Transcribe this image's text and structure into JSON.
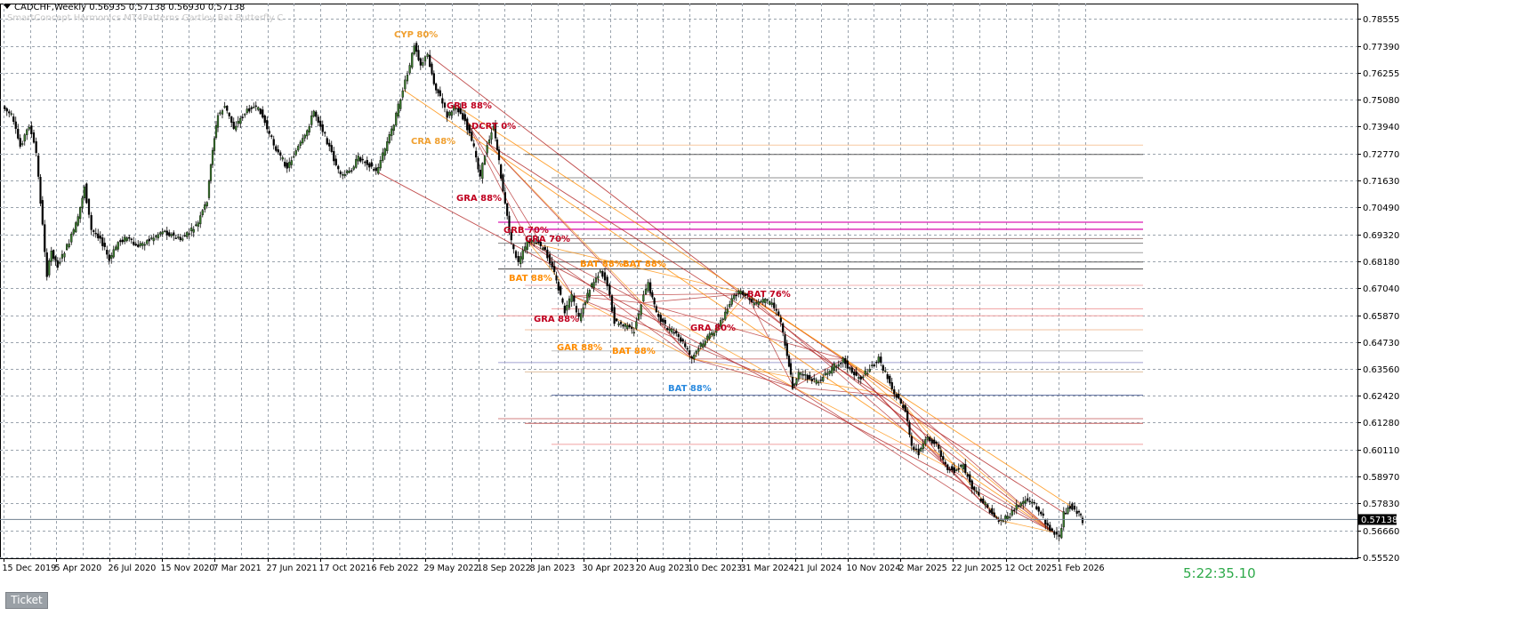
{
  "header": {
    "symbol_line": "CADCHF,Weekly  0.56935 0.57138 0.56930 0.57138",
    "indicator_line": "SmartConcept Harmonics MT4Patterns Gartley Bat Butterfly C"
  },
  "ticket_button": {
    "label": "Ticket"
  },
  "countdown": {
    "text": "5:22:35.10"
  },
  "colors": {
    "bull": "#3a7d2c",
    "bear": "#000000",
    "grid": "#9aa3ad",
    "pattern_red": "#b22222",
    "pattern_orange": "#ff8c00",
    "price_label_bg": "#000000"
  },
  "chart_data": {
    "type": "candlestick",
    "symbol": "CADCHF",
    "timeframe": "Weekly",
    "last_price": "0.57138",
    "ylim": [
      0.5552,
      0.7905
    ],
    "y_ticks": [
      "0.78555",
      "0.77390",
      "0.76255",
      "0.75080",
      "0.73940",
      "0.72770",
      "0.71630",
      "0.70490",
      "0.69320",
      "0.68180",
      "0.67040",
      "0.65870",
      "0.64730",
      "0.63560",
      "0.62420",
      "0.61280",
      "0.60110",
      "0.58970",
      "0.57830",
      "0.56660",
      "0.55520"
    ],
    "x_ticks": [
      "15 Dec 2019",
      "5 Apr 2020",
      "26 Jul 2020",
      "15 Nov 2020",
      "7 Mar 2021",
      "27 Jun 2021",
      "17 Oct 2021",
      "6 Feb 2022",
      "29 May 2022",
      "18 Sep 2022",
      "8 Jan 2023",
      "30 Apr 2023",
      "20 Aug 2023",
      "10 Dec 2023",
      "31 Mar 2024",
      "21 Jul 2024",
      "10 Nov 2024",
      "2 Mar 2025",
      "22 Jun 2025",
      "12 Oct 2025",
      "1 Feb 2026"
    ],
    "price_path": [
      [
        0,
        0.748
      ],
      [
        10,
        0.744
      ],
      [
        20,
        0.731
      ],
      [
        30,
        0.74
      ],
      [
        38,
        0.728
      ],
      [
        45,
        0.697
      ],
      [
        50,
        0.676
      ],
      [
        55,
        0.686
      ],
      [
        62,
        0.68
      ],
      [
        75,
        0.69
      ],
      [
        85,
        0.7
      ],
      [
        92,
        0.714
      ],
      [
        100,
        0.695
      ],
      [
        110,
        0.692
      ],
      [
        120,
        0.682
      ],
      [
        130,
        0.69
      ],
      [
        140,
        0.692
      ],
      [
        150,
        0.688
      ],
      [
        160,
        0.69
      ],
      [
        170,
        0.692
      ],
      [
        180,
        0.695
      ],
      [
        190,
        0.693
      ],
      [
        200,
        0.691
      ],
      [
        210,
        0.694
      ],
      [
        220,
        0.698
      ],
      [
        230,
        0.708
      ],
      [
        236,
        0.73
      ],
      [
        242,
        0.744
      ],
      [
        250,
        0.748
      ],
      [
        260,
        0.739
      ],
      [
        270,
        0.744
      ],
      [
        280,
        0.748
      ],
      [
        290,
        0.746
      ],
      [
        300,
        0.736
      ],
      [
        310,
        0.728
      ],
      [
        320,
        0.722
      ],
      [
        330,
        0.729
      ],
      [
        340,
        0.735
      ],
      [
        350,
        0.746
      ],
      [
        360,
        0.738
      ],
      [
        370,
        0.728
      ],
      [
        380,
        0.718
      ],
      [
        390,
        0.72
      ],
      [
        400,
        0.726
      ],
      [
        410,
        0.724
      ],
      [
        420,
        0.72
      ],
      [
        430,
        0.73
      ],
      [
        440,
        0.741
      ],
      [
        450,
        0.755
      ],
      [
        458,
        0.765
      ],
      [
        463,
        0.775
      ],
      [
        470,
        0.766
      ],
      [
        478,
        0.77
      ],
      [
        485,
        0.758
      ],
      [
        492,
        0.752
      ],
      [
        500,
        0.744
      ],
      [
        510,
        0.748
      ],
      [
        520,
        0.742
      ],
      [
        530,
        0.73
      ],
      [
        537,
        0.718
      ],
      [
        545,
        0.732
      ],
      [
        552,
        0.74
      ],
      [
        558,
        0.724
      ],
      [
        565,
        0.706
      ],
      [
        572,
        0.69
      ],
      [
        580,
        0.681
      ],
      [
        590,
        0.69
      ],
      [
        600,
        0.69
      ],
      [
        610,
        0.686
      ],
      [
        618,
        0.68
      ],
      [
        625,
        0.67
      ],
      [
        632,
        0.66
      ],
      [
        640,
        0.667
      ],
      [
        648,
        0.657
      ],
      [
        660,
        0.67
      ],
      [
        672,
        0.678
      ],
      [
        680,
        0.672
      ],
      [
        688,
        0.656
      ],
      [
        700,
        0.654
      ],
      [
        710,
        0.652
      ],
      [
        718,
        0.664
      ],
      [
        726,
        0.672
      ],
      [
        735,
        0.66
      ],
      [
        745,
        0.654
      ],
      [
        755,
        0.651
      ],
      [
        765,
        0.647
      ],
      [
        775,
        0.64
      ],
      [
        785,
        0.646
      ],
      [
        795,
        0.65
      ],
      [
        805,
        0.654
      ],
      [
        815,
        0.662
      ],
      [
        825,
        0.668
      ],
      [
        835,
        0.668
      ],
      [
        845,
        0.663
      ],
      [
        855,
        0.665
      ],
      [
        865,
        0.664
      ],
      [
        875,
        0.656
      ],
      [
        882,
        0.642
      ],
      [
        888,
        0.628
      ],
      [
        895,
        0.634
      ],
      [
        905,
        0.632
      ],
      [
        915,
        0.63
      ],
      [
        925,
        0.633
      ],
      [
        935,
        0.637
      ],
      [
        945,
        0.64
      ],
      [
        955,
        0.634
      ],
      [
        965,
        0.632
      ],
      [
        975,
        0.636
      ],
      [
        985,
        0.64
      ],
      [
        995,
        0.632
      ],
      [
        1005,
        0.624
      ],
      [
        1015,
        0.618
      ],
      [
        1022,
        0.602
      ],
      [
        1030,
        0.6
      ],
      [
        1040,
        0.606
      ],
      [
        1050,
        0.604
      ],
      [
        1060,
        0.594
      ],
      [
        1070,
        0.592
      ],
      [
        1080,
        0.594
      ],
      [
        1090,
        0.585
      ],
      [
        1100,
        0.58
      ],
      [
        1110,
        0.575
      ],
      [
        1120,
        0.571
      ],
      [
        1130,
        0.572
      ],
      [
        1140,
        0.577
      ],
      [
        1150,
        0.58
      ],
      [
        1160,
        0.578
      ],
      [
        1170,
        0.572
      ],
      [
        1180,
        0.566
      ],
      [
        1188,
        0.563
      ],
      [
        1193,
        0.574
      ],
      [
        1200,
        0.577
      ],
      [
        1208,
        0.575
      ],
      [
        1214,
        0.571
      ]
    ],
    "pattern_labels": [
      {
        "text": "CYP 80%",
        "color": "#f0a030"
      },
      {
        "text": "GRB 88%",
        "color": "#c0001f"
      },
      {
        "text": "CRA 88%",
        "color": "#f0a030"
      },
      {
        "text": "DCRT 0%",
        "color": "#c0001f"
      },
      {
        "text": "GRA 88%",
        "color": "#c0001f"
      },
      {
        "text": "GRB 70%",
        "color": "#c0001f"
      },
      {
        "text": "GRA 70%",
        "color": "#c0001f"
      },
      {
        "text": "BAT 88%",
        "color": "#ff8c00"
      },
      {
        "text": "BAT 88%",
        "color": "#ff8c00"
      },
      {
        "text": "BAT 88%",
        "color": "#ff8c00"
      },
      {
        "text": "GRA 88%",
        "color": "#c0001f"
      },
      {
        "text": "GAR 88%",
        "color": "#ff8c00"
      },
      {
        "text": "BAT 88%",
        "color": "#ff8c00"
      },
      {
        "text": "GRA 80%",
        "color": "#c0001f"
      },
      {
        "text": "BAT 88%",
        "color": "#2a8adf"
      },
      {
        "text": "BAT 76%",
        "color": "#c0001f"
      }
    ]
  }
}
